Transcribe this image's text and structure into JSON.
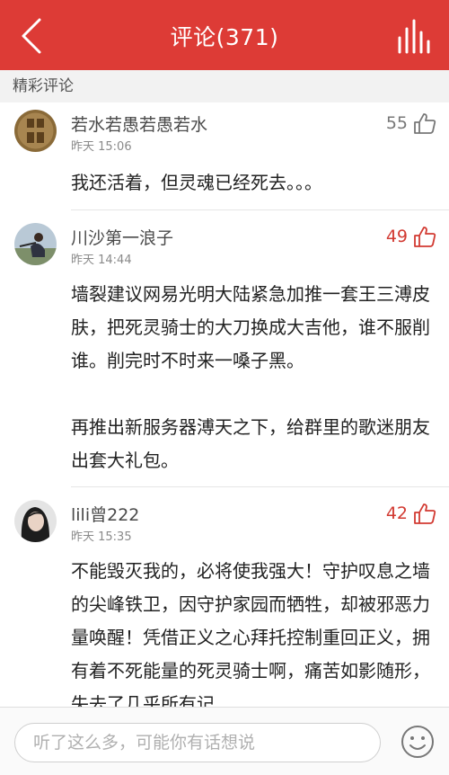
{
  "header": {
    "title": "评论(371)"
  },
  "section": {
    "label": "精彩评论"
  },
  "comments": [
    {
      "username": "若水若愚若愚若水",
      "time": "昨天 15:06",
      "likes": "55",
      "liked": false,
      "paragraphs": [
        "我还活着，但灵魂已经死去。。。"
      ]
    },
    {
      "username": "川沙第一浪子",
      "time": "昨天 14:44",
      "likes": "49",
      "liked": true,
      "paragraphs": [
        "墙裂建议网易光明大陆紧急加推一套王三溥皮肤，把死灵骑士的大刀换成大吉他，谁不服削谁。削完时不时来一嗓子黑。",
        "再推出新服务器溥天之下，给群里的歌迷朋友出套大礼包。"
      ]
    },
    {
      "username": "lili曾222",
      "time": "昨天 15:35",
      "likes": "42",
      "liked": true,
      "paragraphs": [
        "不能毁灭我的，必将使我强大！守护叹息之墙的尖峰铁卫，因守护家园而牺牲，却被邪恶力量唤醒！凭借正义之心拜托控制重回正义，拥有着不死能量的死灵骑士啊，痛苦如影随形，失去了几乎所有记"
      ]
    }
  ],
  "footer": {
    "placeholder": "听了这么多，可能你有话想说"
  },
  "colors": {
    "brand": "#dd3b36",
    "hot_like": "#d23a32"
  }
}
